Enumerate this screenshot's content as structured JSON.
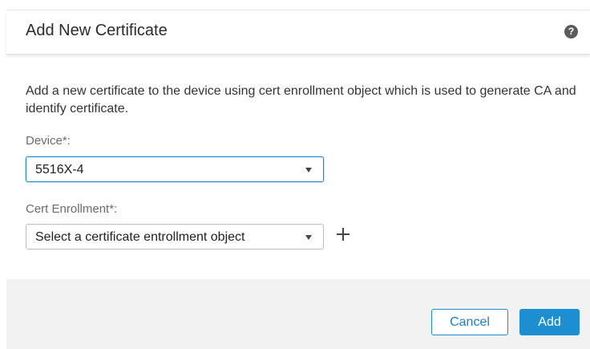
{
  "dialog": {
    "title": "Add New Certificate",
    "help_icon": "help-icon",
    "help_glyph": "?",
    "description": "Add a new certificate to the device using cert enrollment object which is used to generate CA and identify certificate."
  },
  "device": {
    "label": "Device*:",
    "selected_value": "5516X-4"
  },
  "cert_enrollment": {
    "label": "Cert Enrollment*:",
    "placeholder": "Select a certificate entrollment object",
    "add_icon": "plus-icon"
  },
  "footer": {
    "cancel_label": "Cancel",
    "add_label": "Add"
  },
  "colors": {
    "accent": "#1d8fd0",
    "footer_background": "#f2f2f2"
  }
}
